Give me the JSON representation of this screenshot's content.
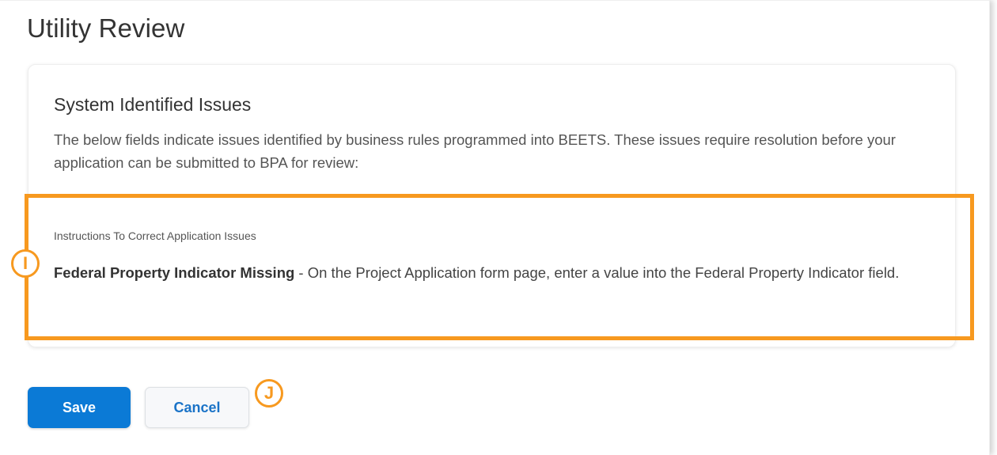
{
  "page": {
    "title": "Utility Review"
  },
  "issues_section": {
    "title": "System Identified Issues",
    "description": "The below fields indicate issues identified by business rules programmed into BEETS.  These issues require resolution before your application can be submitted to BPA for review:",
    "field_label": "Instructions To Correct Application Issues",
    "issue_name": "Federal Property Indicator Missing",
    "issue_text": " - On the Project Application form page, enter a value into the Federal Property Indicator field."
  },
  "callouts": {
    "i": "I",
    "j": "J"
  },
  "buttons": {
    "save_label": "Save",
    "cancel_label": "Cancel"
  },
  "colors": {
    "accent": "#f7991f",
    "primary_button": "#0b7ad6",
    "link_text": "#1a73c7"
  }
}
